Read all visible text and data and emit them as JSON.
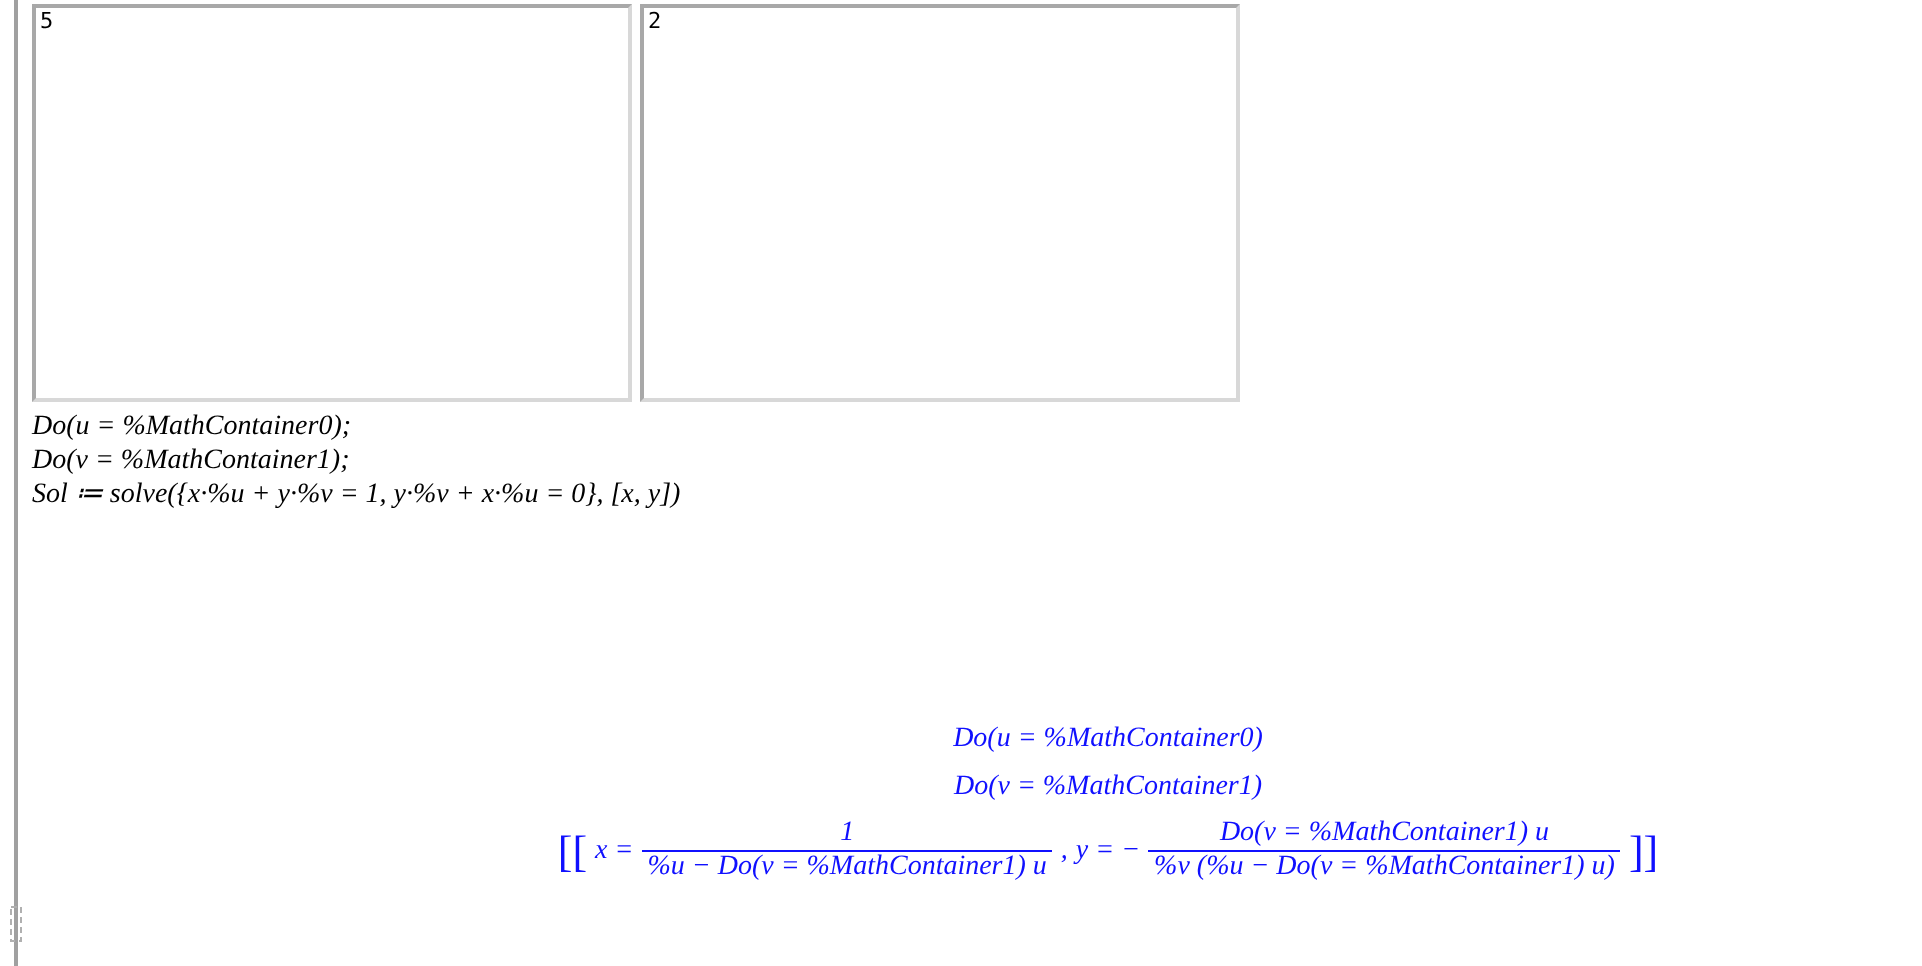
{
  "math_containers": [
    {
      "value": "5"
    },
    {
      "value": "2"
    }
  ],
  "input_lines": [
    "Do(u = %MathContainer0);",
    "Do(v = %MathContainer1);",
    "Sol ≔ solve({x·%u + y·%v = 1, y·%v + x·%u = 0}, [x, y])"
  ],
  "output": {
    "lines": [
      "Do(u = %MathContainer0)",
      "Do(v = %MathContainer1)"
    ],
    "solution": {
      "open": "[[",
      "x_label": "x =",
      "x_numerator": "1",
      "x_denominator": "%u − Do(v = %MathContainer1) u",
      "separator": ",",
      "y_label": "y = −",
      "y_numerator": "Do(v = %MathContainer1) u",
      "y_denominator": "%v (%u − Do(v = %MathContainer1) u)",
      "close": "]]"
    }
  }
}
